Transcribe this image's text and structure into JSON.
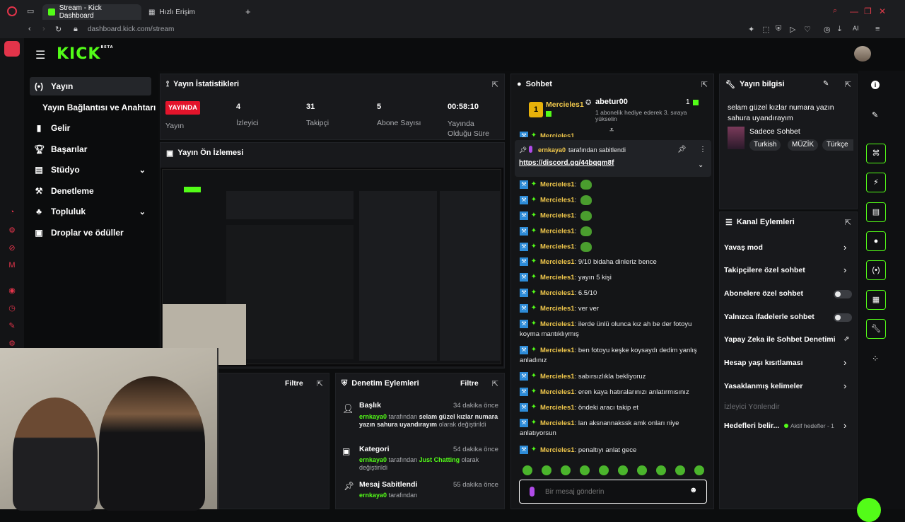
{
  "browser": {
    "tabs": [
      {
        "label": "Stream - Kick Dashboard"
      },
      {
        "label": "Hızlı Erişim"
      }
    ],
    "url": "dashboard.kick.com/stream",
    "ai_label": "AI"
  },
  "nav": {
    "items": [
      {
        "label": "Yayın"
      },
      {
        "label": "Yayın Bağlantısı ve Anahtarı"
      },
      {
        "label": "Gelir"
      },
      {
        "label": "Başarılar"
      },
      {
        "label": "Stüdyo"
      },
      {
        "label": "Denetleme"
      },
      {
        "label": "Topluluk"
      },
      {
        "label": "Droplar ve ödüller"
      }
    ]
  },
  "logo": {
    "text": "KICK",
    "beta": "BETA"
  },
  "stats": {
    "title": "Yayın İstatistikleri",
    "live_badge": "YAYINDA",
    "live_label": "Yayın",
    "items": [
      {
        "value": "4",
        "label": "İzleyici"
      },
      {
        "value": "31",
        "label": "Takipçi"
      },
      {
        "value": "5",
        "label": "Abone Sayısı"
      },
      {
        "value": "00:58:10",
        "label": "Yayında Olduğu Süre"
      }
    ]
  },
  "preview": {
    "title": "Yayın Ön İzlemesi"
  },
  "chat": {
    "title": "Sohbet",
    "top_gifter": {
      "name": "Mercieles1",
      "rank": "1",
      "count": "1"
    },
    "gift_event": {
      "name": "abetur00",
      "text": "1 abonelik hediye ederek 3. sıraya yükselin"
    },
    "pinned": {
      "by": "ernkaya0",
      "suffix": "tarafından sabitlendi",
      "link": "https://discord.gg/44bqqm8f"
    },
    "messages": [
      {
        "user": "Mercieles1",
        "text": "",
        "emote": true
      },
      {
        "user": "Mercieles1",
        "text": "",
        "emote": true
      },
      {
        "user": "Mercieles1",
        "text": "",
        "emote": true
      },
      {
        "user": "Mercieles1",
        "text": "",
        "emote": true
      },
      {
        "user": "Mercieles1",
        "text": "",
        "emote": true
      },
      {
        "user": "Mercieles1",
        "text": "9/10 bidaha dinleriz bence"
      },
      {
        "user": "Mercieles1",
        "text": "yayın 5 kişi"
      },
      {
        "user": "Mercieles1",
        "text": "6.5/10"
      },
      {
        "user": "Mercieles1",
        "text": "ver ver"
      },
      {
        "user": "Mercieles1",
        "text": "ilerde ünlü olunca kız ah be der fotoyu koyma mantıklıymış"
      },
      {
        "user": "Mercieles1",
        "text": "ben fotoyu keşke koysaydı dedim yanlış anladınız"
      },
      {
        "user": "Mercieles1",
        "text": "sabırsızlıkla bekliyoruz"
      },
      {
        "user": "Mercieles1",
        "text": "eren kaya hatıralarınızı anlatırmısınız"
      },
      {
        "user": "Mercieles1",
        "text": "öndeki aracı takip et"
      },
      {
        "user": "Mercieles1",
        "text": "lan aksnannakssk amk onları niye anlatıyorsun"
      },
      {
        "user": "Mercieles1",
        "text": "penaltıyı anlat gece"
      }
    ],
    "input_placeholder": "Bir mesaj gönderin"
  },
  "stream_info": {
    "title": "Yayın bilgisi",
    "stream_title": "selam güzel kızlar numara yazın sahura uyandırayım",
    "category": "Sadece Sohbet",
    "tags": [
      "Turkish",
      "MÜZİK",
      "Türkçe"
    ]
  },
  "channel_actions": {
    "title": "Kanal Eylemleri",
    "items": [
      {
        "label": "Yavaş mod",
        "control": "chevron"
      },
      {
        "label": "Takipçilere özel sohbet",
        "control": "chevron"
      },
      {
        "label": "Abonelere özel sohbet",
        "control": "toggle",
        "on": false
      },
      {
        "label": "Yalnızca ifadelerle sohbet",
        "control": "toggle",
        "on": false
      },
      {
        "label": "Yapay Zeka ile Sohbet Denetimi",
        "control": "external"
      },
      {
        "label": "Hesap yaşı kısıtlaması",
        "control": "chevron"
      },
      {
        "label": "Yasaklanmış kelimeler",
        "control": "chevron"
      }
    ],
    "section_label": "İzleyici Yönlendir",
    "target": {
      "label": "Hedefleri belir...",
      "status": "Aktif hedefler - 1"
    }
  },
  "moderation": {
    "title": "Denetim Eylemleri",
    "filter_label": "Filtre",
    "left_filter_label": "Filtre",
    "items": [
      {
        "title": "Başlık",
        "time": "34 dakika önce",
        "actor": "ernkaya0",
        "pre": "tarafından",
        "value": "selam güzel kızlar numara yazın sahura uyandırayım",
        "post": "olarak değiştirildi"
      },
      {
        "title": "Kategori",
        "time": "54 dakika önce",
        "actor": "ernkaya0",
        "pre": "tarafından",
        "value": "Just Chatting",
        "post": "olarak değiştirildi"
      },
      {
        "title": "Mesaj Sabitlendi",
        "time": "55 dakika önce",
        "actor": "ernkaya0",
        "pre": "tarafından",
        "value": "",
        "post": ""
      }
    ]
  },
  "colors": {
    "accent": "#53fc18",
    "live": "#e3142b",
    "username": "#f2c94c"
  }
}
